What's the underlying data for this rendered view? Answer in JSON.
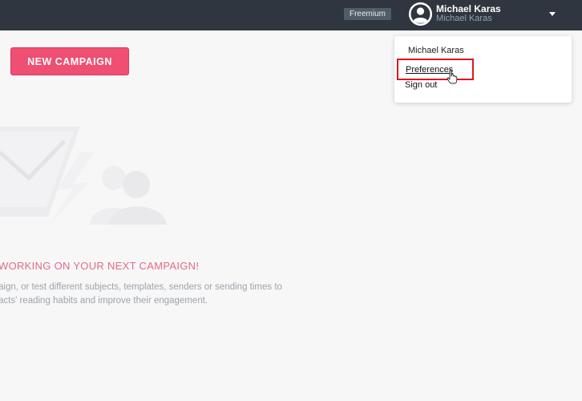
{
  "header": {
    "plan_badge": "Freemium",
    "user": {
      "name": "Michael Karas",
      "subtitle": "Michael Karas"
    },
    "icons": {
      "avatar": "user-avatar-icon",
      "menu_toggle": "caret-down-icon"
    }
  },
  "toolbar": {
    "new_campaign_label": "NEW CAMPAIGN"
  },
  "empty_state": {
    "title": "WORKING ON YOUR NEXT CAMPAIGN!",
    "line1": "aign, or test different subjects, templates, senders or sending times to",
    "line2": "acts' reading habits and improve their engagement."
  },
  "user_menu": {
    "name": "Michael Karas",
    "items": [
      {
        "label": "Preferences",
        "highlighted": true
      },
      {
        "label": "Sign out"
      }
    ]
  },
  "colors": {
    "topbar": "#2f363f",
    "accent": "#ef4f72",
    "highlight_box": "#e2151c",
    "background": "#f7f7f8"
  }
}
